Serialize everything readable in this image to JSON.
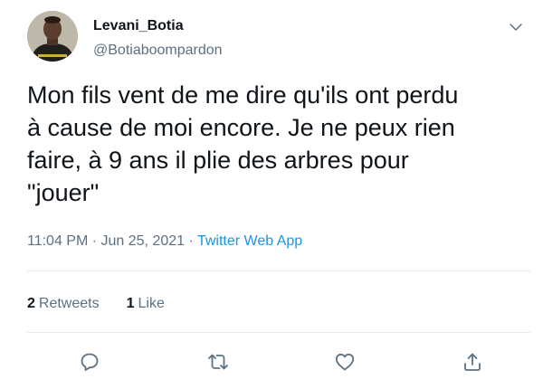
{
  "author": {
    "display_name": "Levani_Botia",
    "handle": "@Botiaboompardon"
  },
  "tweet": {
    "text": "Mon fils vent de me dire qu'ils ont perdu\nà cause de moi encore. Je ne peux rien\nfaire, à 9 ans il plie des arbres pour\n\"jouer\"",
    "time": "11:04 PM",
    "separator": " · ",
    "date": "Jun 25, 2021",
    "source": "Twitter Web App"
  },
  "stats": {
    "retweets_count": "2",
    "retweets_label": "Retweets",
    "likes_count": "1",
    "likes_label": "Like"
  },
  "actions": {
    "reply_icon": "reply-icon",
    "retweet_icon": "retweet-icon",
    "like_icon": "heart-icon",
    "share_icon": "share-icon"
  },
  "colors": {
    "text": "#0f1419",
    "secondary": "#5b7083",
    "link": "#1b95e0",
    "divider": "#e6ecf0"
  }
}
